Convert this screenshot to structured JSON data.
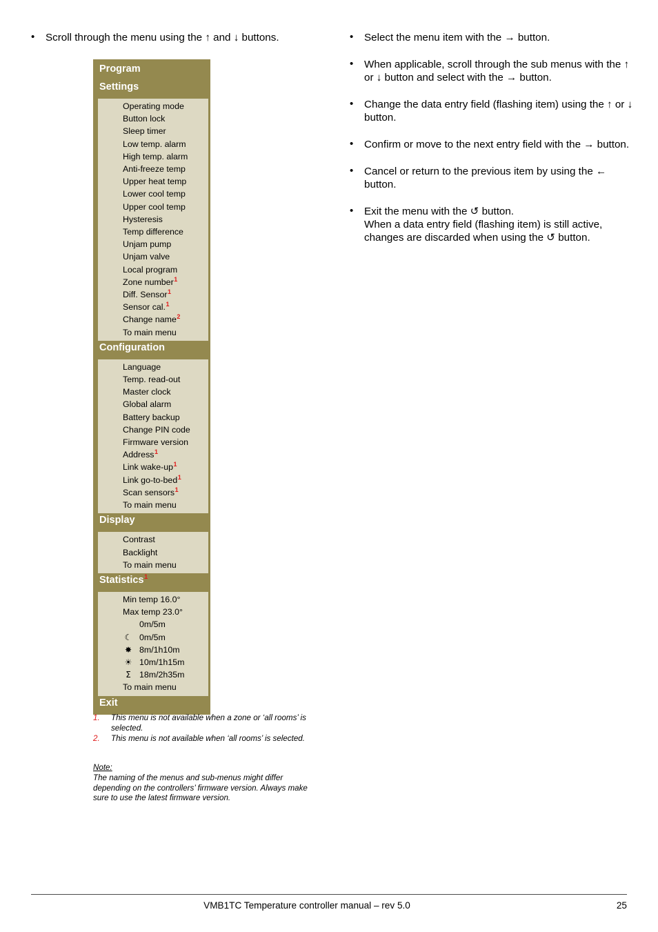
{
  "left_intro": {
    "bullets": [
      "Scroll through the menu using the ↑ and ↓ buttons."
    ]
  },
  "right_instructions": {
    "bullets": [
      "Select the menu item with the → button.",
      "When applicable, scroll through the sub menus with the ↑ or ↓ button and select with the → button.",
      "Change the data entry field (flashing item) using the ↑ or ↓ button.",
      "Confirm or move to the next entry field with the → button.",
      "Cancel or return to the previous item by using the ← button.",
      "Exit the menu with the ↺ button.\nWhen a data entry field (flashing item) is still active, changes are discarded when using the ↺ button."
    ]
  },
  "menu_diagram": {
    "colors": {
      "header_bg": "#94894f",
      "body_bg": "#ddd9c3",
      "header_text": "#ffffff",
      "footnote_marker": "#e01b1b"
    },
    "title": "Program",
    "sections": [
      {
        "header": "Settings",
        "header_note": "",
        "items": [
          {
            "label": "Operating mode",
            "note": ""
          },
          {
            "label": "Button lock",
            "note": ""
          },
          {
            "label": "Sleep timer",
            "note": ""
          },
          {
            "label": "Low temp. alarm",
            "note": ""
          },
          {
            "label": "High temp. alarm",
            "note": ""
          },
          {
            "label": "Anti-freeze temp",
            "note": ""
          },
          {
            "label": "Upper heat temp",
            "note": ""
          },
          {
            "label": "Lower cool temp",
            "note": ""
          },
          {
            "label": "Upper cool temp",
            "note": ""
          },
          {
            "label": "Hysteresis",
            "note": ""
          },
          {
            "label": "Temp difference",
            "note": ""
          },
          {
            "label": "Unjam pump",
            "note": ""
          },
          {
            "label": "Unjam valve",
            "note": ""
          },
          {
            "label": "Local program",
            "note": ""
          },
          {
            "label": "Zone number",
            "note": "1"
          },
          {
            "label": "Diff. Sensor",
            "note": "1"
          },
          {
            "label": "Sensor cal.",
            "note": "1"
          },
          {
            "label": "Change name",
            "note": "2"
          },
          {
            "label": "To main menu",
            "note": ""
          }
        ]
      },
      {
        "header": "Configuration",
        "header_note": "",
        "items": [
          {
            "label": "Language",
            "note": ""
          },
          {
            "label": "Temp. read-out",
            "note": ""
          },
          {
            "label": "Master clock",
            "note": ""
          },
          {
            "label": "Global alarm",
            "note": ""
          },
          {
            "label": "Battery backup",
            "note": ""
          },
          {
            "label": "Change PIN code",
            "note": ""
          },
          {
            "label": "Firmware version",
            "note": ""
          },
          {
            "label": "Address",
            "note": "1"
          },
          {
            "label": "Link wake-up",
            "note": "1"
          },
          {
            "label": "Link go-to-bed",
            "note": "1"
          },
          {
            "label": "Scan sensors",
            "note": "1"
          },
          {
            "label": "To main menu",
            "note": ""
          }
        ]
      },
      {
        "header": "Display",
        "header_note": "",
        "items": [
          {
            "label": "Contrast",
            "note": ""
          },
          {
            "label": "Backlight",
            "note": ""
          },
          {
            "label": "To main menu",
            "note": ""
          }
        ]
      },
      {
        "header": "Statistics",
        "header_note": "1",
        "items": [
          {
            "label": "Min temp 16.0°",
            "note": "",
            "indent": "text"
          },
          {
            "label": "Max temp 23.0°",
            "note": "",
            "indent": "text"
          },
          {
            "label": "0m/5m",
            "note": "",
            "icon": "",
            "icon_name": "no-icon"
          },
          {
            "label": "0m/5m",
            "note": "",
            "icon": "☾",
            "icon_name": "moon-icon"
          },
          {
            "label": "8m/1h10m",
            "note": "",
            "icon": "✸",
            "icon_name": "snowflake-icon"
          },
          {
            "label": "10m/1h15m",
            "note": "",
            "icon": "☀",
            "icon_name": "sun-icon"
          },
          {
            "label": "18m/2h35m",
            "note": "",
            "icon": "Σ",
            "icon_name": "sigma-icon"
          },
          {
            "label": "To main menu",
            "note": "",
            "indent": "text"
          }
        ]
      }
    ],
    "exit_label": "Exit"
  },
  "footnotes": [
    {
      "num": "1.",
      "text": "This menu is not available when a zone or ‘all rooms’ is selected."
    },
    {
      "num": "2.",
      "text": "This menu is not available when ‘all rooms’ is selected."
    }
  ],
  "note": {
    "title": "Note:",
    "text": "The naming of the menus and sub-menus might differ depending on the controllers’ firmware version. Always make sure to use the latest firmware version."
  },
  "footer": {
    "text": "VMB1TC Temperature controller manual – rev 5.0",
    "page": "25"
  }
}
